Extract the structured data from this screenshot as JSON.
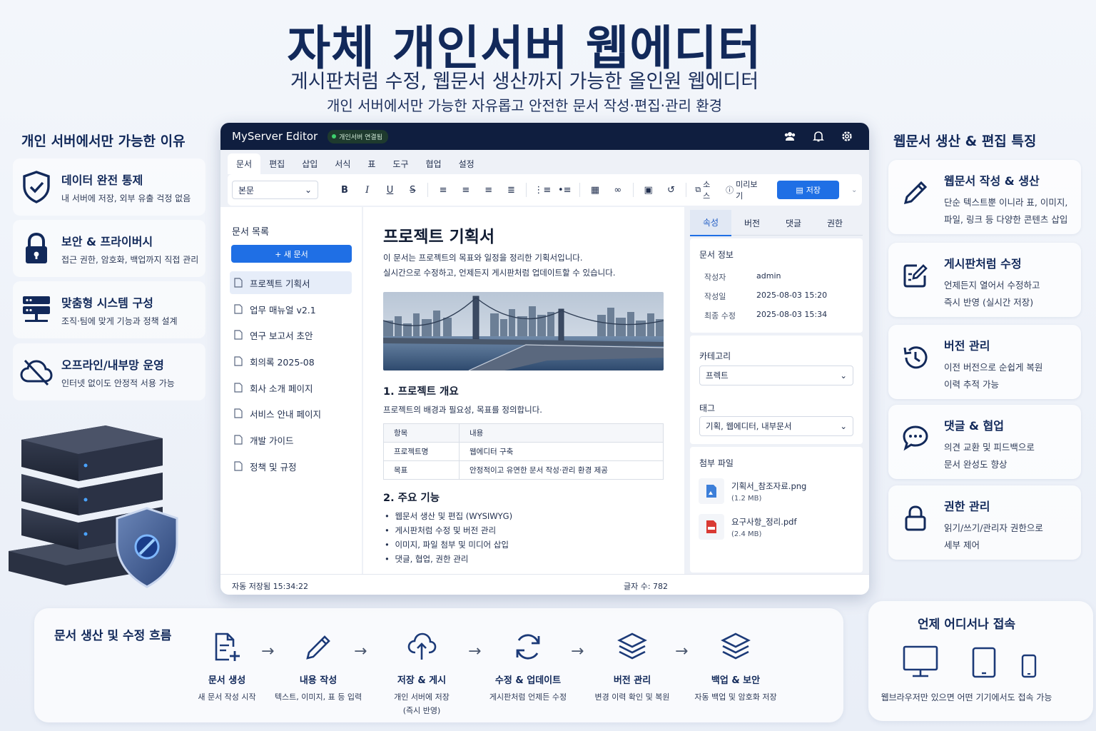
{
  "hero": {
    "title": "자체 개인서버 웹에디터",
    "subtitle": "게시판처럼 수정, 웹문서 생산까지 가능한 올인원 웹에디터",
    "tagline": "개인 서버에서만 가능한 자유롭고 안전한 문서 작성·편집·관리 환경"
  },
  "left_panel": {
    "title": "개인 서버에서만 가능한 이유",
    "items": [
      {
        "icon": "shield-check-icon",
        "title": "데이터 완전 통제",
        "desc": "내 서버에 저장, 외부 유출 걱정 없음"
      },
      {
        "icon": "lock-icon",
        "title": "보안 & 프라이버시",
        "desc": "접근 권한, 암호화, 백업까지 직접 관리"
      },
      {
        "icon": "server-icon",
        "title": "맞춤형 시스템 구성",
        "desc": "조직·팀에 맞게 기능과 정책 설계"
      },
      {
        "icon": "cloud-off-icon",
        "title": "오프라인/내부망 운영",
        "desc": "인터넷 없이도 안정적 서용 가능"
      }
    ]
  },
  "right_panel": {
    "title": "웹문서 생산 & 편집 특징",
    "items": [
      {
        "icon": "pencil-icon",
        "title": "웹문서 작성 & 생산",
        "desc1": "단순 텍스트뿐 이니라 표, 이미지,",
        "desc2": "파일, 링크 등 다양한 콘텐츠 삽입"
      },
      {
        "icon": "edit-square-icon",
        "title": "게시판처럼 수정",
        "desc1": "언제든지 열어서 수정하고",
        "desc2": "즉시 반영 (실시간 저장)"
      },
      {
        "icon": "history-icon",
        "title": "버전 관리",
        "desc1": "이전 버전으로 순쉽게 복원",
        "desc2": "이력 추적 가능"
      },
      {
        "icon": "chat-icon",
        "title": "댓글 & 협업",
        "desc1": "의견 교환 및 피드백으로",
        "desc2": "문서 완성도 향상"
      },
      {
        "icon": "lock-icon",
        "title": "권한 관리",
        "desc1": "읽기/쓰기/관리자 권한으로",
        "desc2": "세부 제어"
      }
    ]
  },
  "window": {
    "app_name": "MyServer Editor",
    "status_badge": "개인서버 연결됨",
    "menu": [
      "문서",
      "편집",
      "삽입",
      "서식",
      "표",
      "도구",
      "협업",
      "설정"
    ],
    "toolbar": {
      "style_select": "본문",
      "source_label": "소스",
      "preview_label": "미리보기",
      "save_label": "저장"
    },
    "doc_list": {
      "title": "문서 목록",
      "new_button": "+ 새 문서",
      "items": [
        "프로젝트 기획서",
        "업무 매뉴얼 v2.1",
        "연구 보고서 초안",
        "회의록 2025-08",
        "회사 소개 페이지",
        "서비스 안내 페이지",
        "개발 가이드",
        "정책 및 규정"
      ]
    },
    "editor": {
      "title": "프로젝트 기획서",
      "intro1": "이 문서는 프로젝트의 목표와 일정을 정리한 기획서입니다.",
      "intro2": "실시간으로 수정하고, 언제든지 게시판처럼 업데이트할 수 있습니다.",
      "h2_1": "1. 프로젝트 개요",
      "p1": "프로젝트의 배경과 필요성, 목표를 정의합니다.",
      "table": [
        [
          "항목",
          "내용"
        ],
        [
          "프로젝트명",
          "웹에디터 구축"
        ],
        [
          "목표",
          "안정적이고 유연한 문서 작성·관리 환경 제공"
        ]
      ],
      "h2_2": "2. 주요 기능",
      "features": [
        "웹문서 생산 및 편집 (WYSIWYG)",
        "게시판처럼 수정 및 버전 관리",
        "이미지, 파일 첨부 및 미디어 삽입",
        "댓글, 협업, 권한 관리"
      ]
    },
    "props": {
      "tabs": [
        "속성",
        "버전",
        "댓글",
        "권한"
      ],
      "doc_info_title": "문서 정보",
      "author_label": "작성자",
      "author": "admin",
      "created_label": "작성일",
      "created": "2025-08-03 15:20",
      "modified_label": "최종 수정",
      "modified": "2025-08-03 15:34",
      "category_title": "카테고리",
      "category": "프렉트",
      "tag_title": "태그",
      "tags": "기획, 웹에디터, 내부문서",
      "attach_title": "첨부 파일",
      "files": [
        {
          "name": "기획서_참조자료.png",
          "size": "(1.2 MB)"
        },
        {
          "name": "요구사항_정리.pdf",
          "size": "(2.4 MB)"
        }
      ]
    },
    "statusbar": {
      "autosave": "자동 저장됨  15:34:22",
      "wordcount": "글자 수: 782"
    }
  },
  "flow": {
    "title": "문서 생산 및 수정 흐름",
    "steps": [
      {
        "icon": "file-plus-icon",
        "title": "문서 생성",
        "desc": "새 문서 작성 시작"
      },
      {
        "icon": "pencil-icon",
        "title": "내용 작성",
        "desc": "텍스트, 이미지, 표 등 입력"
      },
      {
        "icon": "cloud-upload-icon",
        "title": "저장 & 게시",
        "desc": "개인 서버에 저장",
        "desc2": "(즉시 반영)"
      },
      {
        "icon": "refresh-icon",
        "title": "수정 & 업데이트",
        "desc": "게시판처럼 언제든 수정"
      },
      {
        "icon": "layers-icon",
        "title": "버전 관리",
        "desc": "변경 이력 확인 및 복원"
      },
      {
        "icon": "layers-icon",
        "title": "백업 & 보안",
        "desc": "자동 백업 및 암호화 저장"
      }
    ]
  },
  "access": {
    "title": "언제 어디서나 접속",
    "desc": "웹브라우저만 있으면 어떤 기기에서도 접속 가능"
  },
  "colors": {
    "navy": "#12295a",
    "accent": "#1f6fe5",
    "titlebar": "#0f1e3f"
  }
}
